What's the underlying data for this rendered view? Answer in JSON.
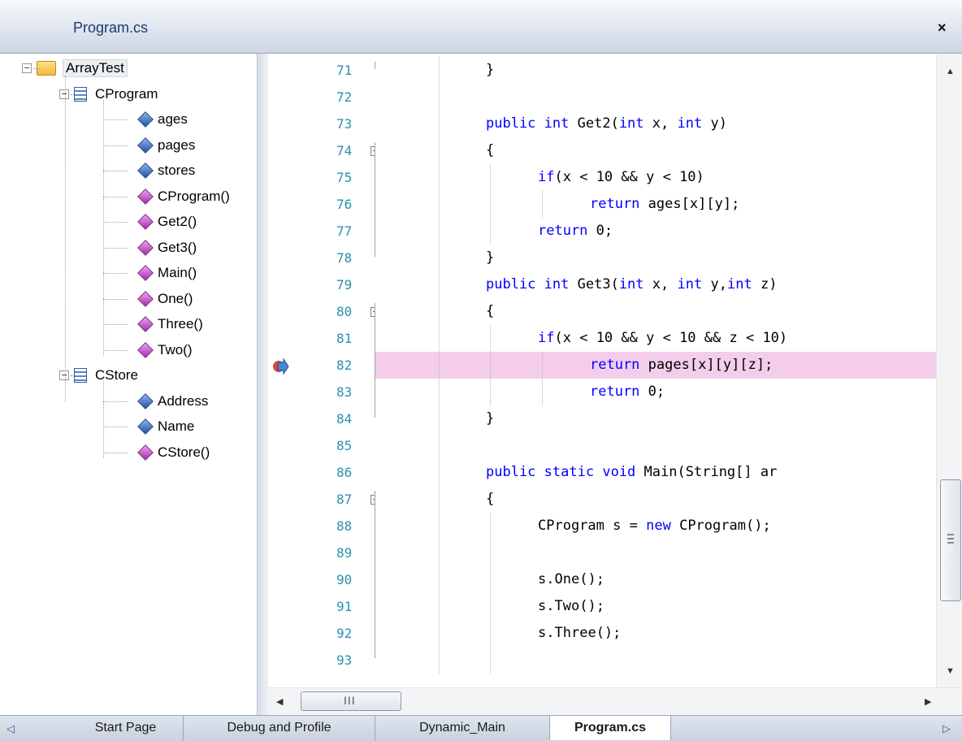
{
  "window": {
    "title": "Program.cs",
    "close_label": "×"
  },
  "tree": {
    "root": {
      "label": "ArrayTest",
      "icon": "folder-icon",
      "expander": "−"
    },
    "classes": [
      {
        "label": "CProgram",
        "icon": "class-icon",
        "expander": "−",
        "members": [
          {
            "label": "ages",
            "kind": "field"
          },
          {
            "label": "pages",
            "kind": "field"
          },
          {
            "label": "stores",
            "kind": "field"
          },
          {
            "label": "CProgram()",
            "kind": "method"
          },
          {
            "label": "Get2()",
            "kind": "method"
          },
          {
            "label": "Get3()",
            "kind": "method"
          },
          {
            "label": "Main()",
            "kind": "method"
          },
          {
            "label": "One()",
            "kind": "method"
          },
          {
            "label": "Three()",
            "kind": "method"
          },
          {
            "label": "Two()",
            "kind": "method"
          }
        ]
      },
      {
        "label": "CStore",
        "icon": "class-icon",
        "expander": "−",
        "members": [
          {
            "label": "Address",
            "kind": "field"
          },
          {
            "label": "Name",
            "kind": "field"
          },
          {
            "label": "CStore()",
            "kind": "method"
          }
        ]
      }
    ]
  },
  "editor": {
    "current_line": 82,
    "lines": [
      {
        "n": "71",
        "text": "}",
        "indent": 0
      },
      {
        "n": "72",
        "text": "",
        "indent": 0
      },
      {
        "n": "73",
        "text": "public int Get2(int x, int y)",
        "indent": 0
      },
      {
        "n": "74",
        "text": "{",
        "indent": 0,
        "fold": "−"
      },
      {
        "n": "75",
        "text": "if(x < 10 && y < 10)",
        "indent": 1
      },
      {
        "n": "76",
        "text": "return ages[x][y];",
        "indent": 2
      },
      {
        "n": "77",
        "text": "return 0;",
        "indent": 1
      },
      {
        "n": "78",
        "text": "}",
        "indent": 0
      },
      {
        "n": "79",
        "text": "public int Get3(int x, int y,int z)",
        "indent": 0
      },
      {
        "n": "80",
        "text": "{",
        "indent": 0,
        "fold": "−"
      },
      {
        "n": "81",
        "text": "if(x < 10 && y < 10 && z < 10)",
        "indent": 1
      },
      {
        "n": "82",
        "text": "return pages[x][y][z];",
        "indent": 2,
        "highlight": true
      },
      {
        "n": "83",
        "text": "return 0;",
        "indent": 2
      },
      {
        "n": "84",
        "text": "}",
        "indent": 0
      },
      {
        "n": "85",
        "text": "",
        "indent": 0
      },
      {
        "n": "86",
        "text": "public static void Main(String[] ar",
        "indent": 0
      },
      {
        "n": "87",
        "text": "{",
        "indent": 0,
        "fold": "−"
      },
      {
        "n": "88",
        "text": "CProgram s = new CProgram();",
        "indent": 1
      },
      {
        "n": "89",
        "text": "",
        "indent": 0
      },
      {
        "n": "90",
        "text": "s.One();",
        "indent": 1
      },
      {
        "n": "91",
        "text": "s.Two();",
        "indent": 1
      },
      {
        "n": "92",
        "text": "s.Three();",
        "indent": 1
      },
      {
        "n": "93",
        "text": "",
        "indent": 0
      }
    ],
    "keywords": [
      "public",
      "static",
      "void",
      "int",
      "if",
      "return",
      "new"
    ],
    "highlight_color": "#f4cdea",
    "keyword_color": "#0000ff",
    "line_number_color": "#2b91af"
  },
  "scrollbars": {
    "vertical": {
      "up_arrow": "▲",
      "down_arrow": "▼"
    },
    "horizontal": {
      "left_arrow": "◀",
      "right_arrow": "▶",
      "thumb_grip": "III"
    }
  },
  "tabs": {
    "prev_label": "◁",
    "next_label": "▷",
    "items": [
      {
        "label": "Start Page",
        "active": false
      },
      {
        "label": "Debug and Profile",
        "active": false
      },
      {
        "label": "Dynamic_Main",
        "active": false
      },
      {
        "label": "Program.cs",
        "active": true
      }
    ]
  }
}
